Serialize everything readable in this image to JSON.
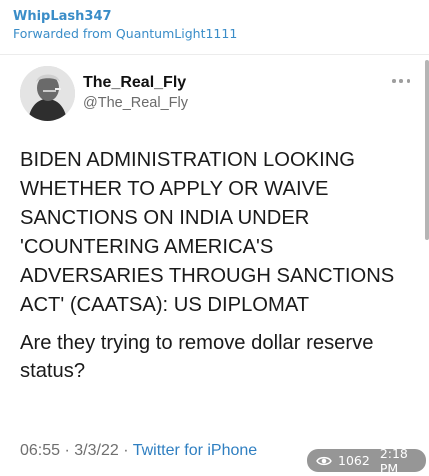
{
  "message": {
    "sender": "WhipLash347",
    "forwarded_from": "Forwarded from QuantumLight1111"
  },
  "tweet": {
    "display_name": "The_Real_Fly",
    "handle": "@The_Real_Fly",
    "headline": "BIDEN ADMINISTRATION LOOKING WHETHER TO APPLY OR WAIVE SANCTIONS ON INDIA UNDER 'COUNTERING AMERICA'S ADVERSARIES THROUGH SANCTIONS ACT' (CAATSA): US DIPLOMAT",
    "question": "Are they trying to remove dollar reserve status?",
    "time": "06:55",
    "separator_1": " · ",
    "date": "3/3/22",
    "separator_2": " · ",
    "source": "Twitter for iPhone"
  },
  "overlay": {
    "views": "1062",
    "time": "2:18 PM",
    "icon": "eye-icon"
  },
  "colors": {
    "link": "#3a8dc8",
    "source": "#2f7fc1",
    "text": "#1a1a1a",
    "muted": "#6b6b6b"
  }
}
